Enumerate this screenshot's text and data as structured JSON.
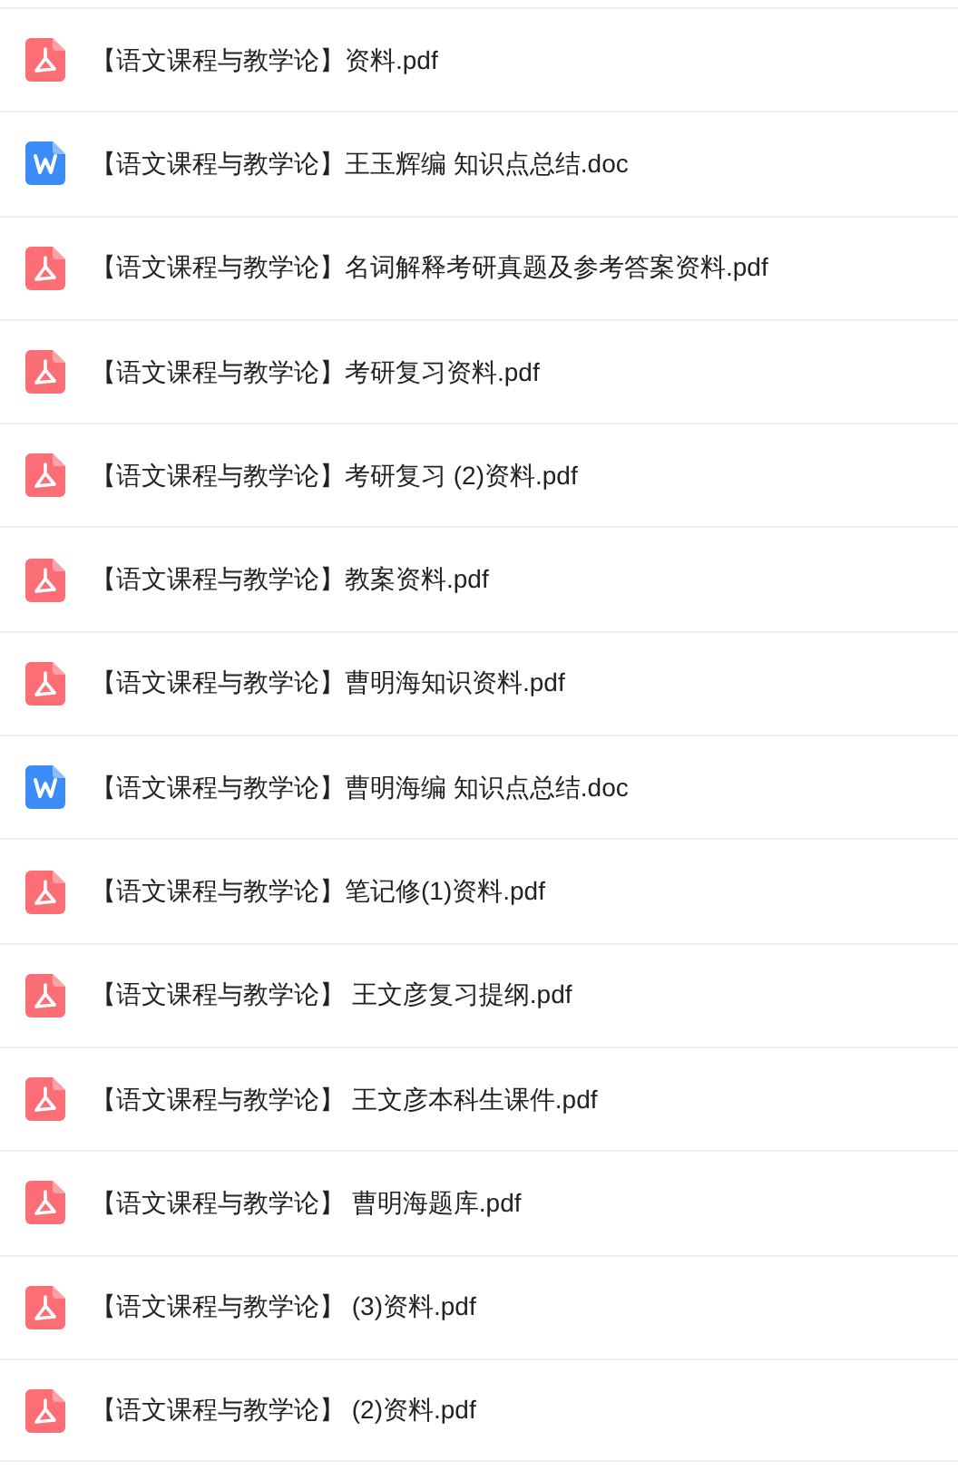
{
  "files": [
    {
      "kind": "pdf",
      "name": "【语文课程与教学论】资料.pdf"
    },
    {
      "kind": "doc",
      "name": "【语文课程与教学论】王玉辉编 知识点总结.doc"
    },
    {
      "kind": "pdf",
      "name": "【语文课程与教学论】名词解释考研真题及参考答案资料.pdf"
    },
    {
      "kind": "pdf",
      "name": "【语文课程与教学论】考研复习资料.pdf"
    },
    {
      "kind": "pdf",
      "name": "【语文课程与教学论】考研复习 (2)资料.pdf"
    },
    {
      "kind": "pdf",
      "name": "【语文课程与教学论】教案资料.pdf"
    },
    {
      "kind": "pdf",
      "name": "【语文课程与教学论】曹明海知识资料.pdf"
    },
    {
      "kind": "doc",
      "name": "【语文课程与教学论】曹明海编 知识点总结.doc"
    },
    {
      "kind": "pdf",
      "name": "【语文课程与教学论】笔记修(1)资料.pdf"
    },
    {
      "kind": "pdf",
      "name": "【语文课程与教学论】 王文彦复习提纲.pdf"
    },
    {
      "kind": "pdf",
      "name": "【语文课程与教学论】 王文彦本科生课件.pdf"
    },
    {
      "kind": "pdf",
      "name": "【语文课程与教学论】 曹明海题库.pdf"
    },
    {
      "kind": "pdf",
      "name": "【语文课程与教学论】 (3)资料.pdf"
    },
    {
      "kind": "pdf",
      "name": "【语文课程与教学论】 (2)资料.pdf"
    }
  ]
}
